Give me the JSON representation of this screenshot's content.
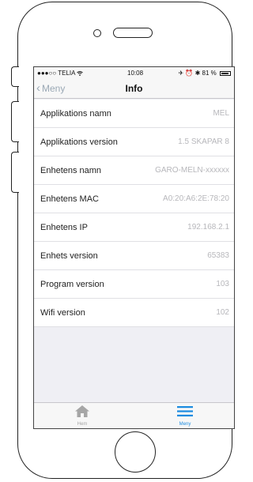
{
  "status": {
    "carrier": "●●●○○ TELIA",
    "wifi_icon": "wifi-icon",
    "time": "10:08",
    "indicators": "✈ ⏰ ✱",
    "battery_text": "81 %"
  },
  "nav": {
    "back_label": "Meny",
    "title": "Info"
  },
  "rows": [
    {
      "label": "Applikations namn",
      "value": "MEL"
    },
    {
      "label": "Applikations version",
      "value": "1.5 SKAPAR 8"
    },
    {
      "label": "Enhetens namn",
      "value": "GARO-MELN-xxxxxx"
    },
    {
      "label": "Enhetens MAC",
      "value": "A0:20:A6:2E:78:20"
    },
    {
      "label": "Enhetens IP",
      "value": "192.168.2.1"
    },
    {
      "label": "Enhets version",
      "value": "65383"
    },
    {
      "label": "Program version",
      "value": "103"
    },
    {
      "label": "Wifi version",
      "value": "102"
    }
  ],
  "tabs": {
    "home": {
      "label": "Hem",
      "icon": "home-icon"
    },
    "menu": {
      "label": "Meny",
      "icon": "menu-icon"
    }
  },
  "colors": {
    "accent": "#1a8be0",
    "inactive": "#a6a6a6",
    "value_text": "#b7b7bb"
  }
}
